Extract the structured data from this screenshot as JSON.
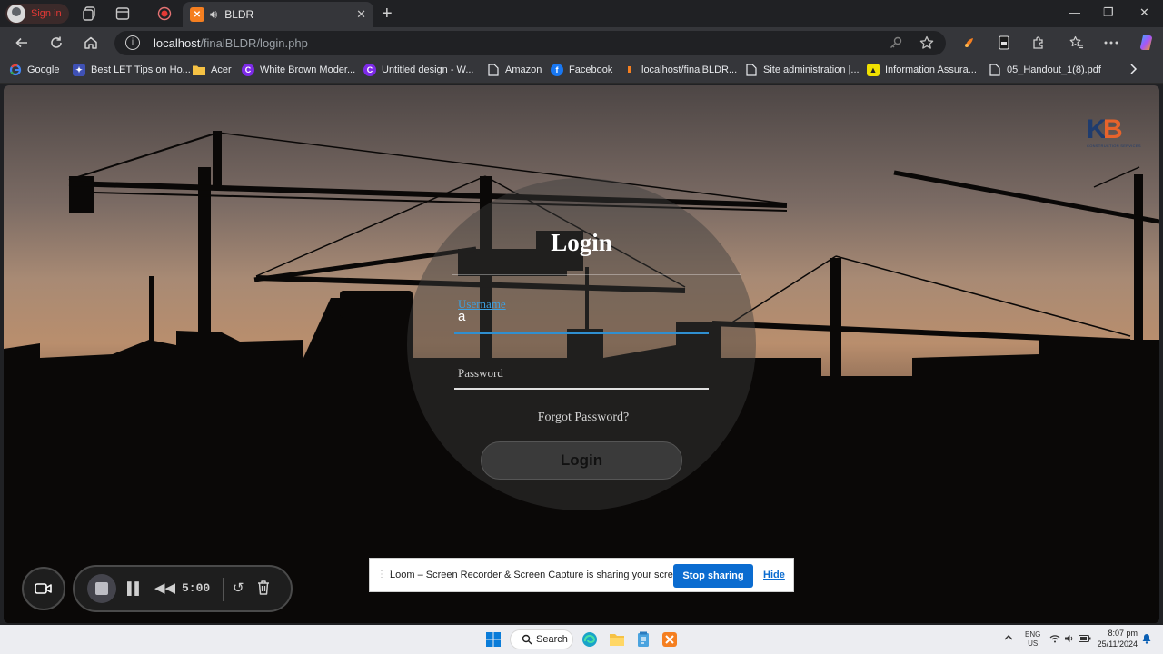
{
  "browser": {
    "profile_label": "Sign in",
    "tab": {
      "title": "BLDR",
      "favicon": "xampp-icon"
    },
    "address": {
      "host": "localhost",
      "path": "/finalBLDR/login.php"
    }
  },
  "bookmarks": [
    {
      "label": "Google",
      "icon": "google-icon",
      "color": "#4285f4"
    },
    {
      "label": "Best LET Tips on Ho...",
      "icon": "site-icon",
      "color": "#3f51b5"
    },
    {
      "label": "Acer",
      "icon": "folder-icon",
      "color": "#f6c244"
    },
    {
      "label": "White Brown Moder...",
      "icon": "canva-icon",
      "color": "#7d2ae8"
    },
    {
      "label": "Untitled design - W...",
      "icon": "canva-icon",
      "color": "#7d2ae8"
    },
    {
      "label": "Amazon",
      "icon": "page-icon",
      "color": "#e8eaed"
    },
    {
      "label": "Facebook",
      "icon": "facebook-icon",
      "color": "#1877f2"
    },
    {
      "label": "localhost/finalBLDR...",
      "icon": "xampp-icon",
      "color": "#f57f20"
    },
    {
      "label": "Site administration |...",
      "icon": "page-icon",
      "color": "#e8eaed"
    },
    {
      "label": "Information Assura...",
      "icon": "site-icon",
      "color": "#f0e000"
    },
    {
      "label": "05_Handout_1(8).pdf",
      "icon": "page-icon",
      "color": "#e8eaed"
    }
  ],
  "login": {
    "title": "Login",
    "username_label": "Username",
    "username_value": "a",
    "password_placeholder": "Password",
    "forgot_link": "Forgot Password?",
    "submit_label": "Login"
  },
  "brand": {
    "letters_left": "K",
    "letters_right": "B",
    "tagline": "CONSTRUCTION SERVICES",
    "colors": {
      "navy": "#1f3c6e",
      "orange": "#e8632b"
    }
  },
  "loom": {
    "timer": "5:00",
    "share_message": "Loom – Screen Recorder & Screen Capture is sharing your screen.",
    "stop_sharing": "Stop sharing",
    "hide": "Hide"
  },
  "taskbar": {
    "search_label": "Search",
    "lang_top": "ENG",
    "lang_bottom": "US",
    "time": "8:07 pm",
    "date": "25/11/2024"
  }
}
